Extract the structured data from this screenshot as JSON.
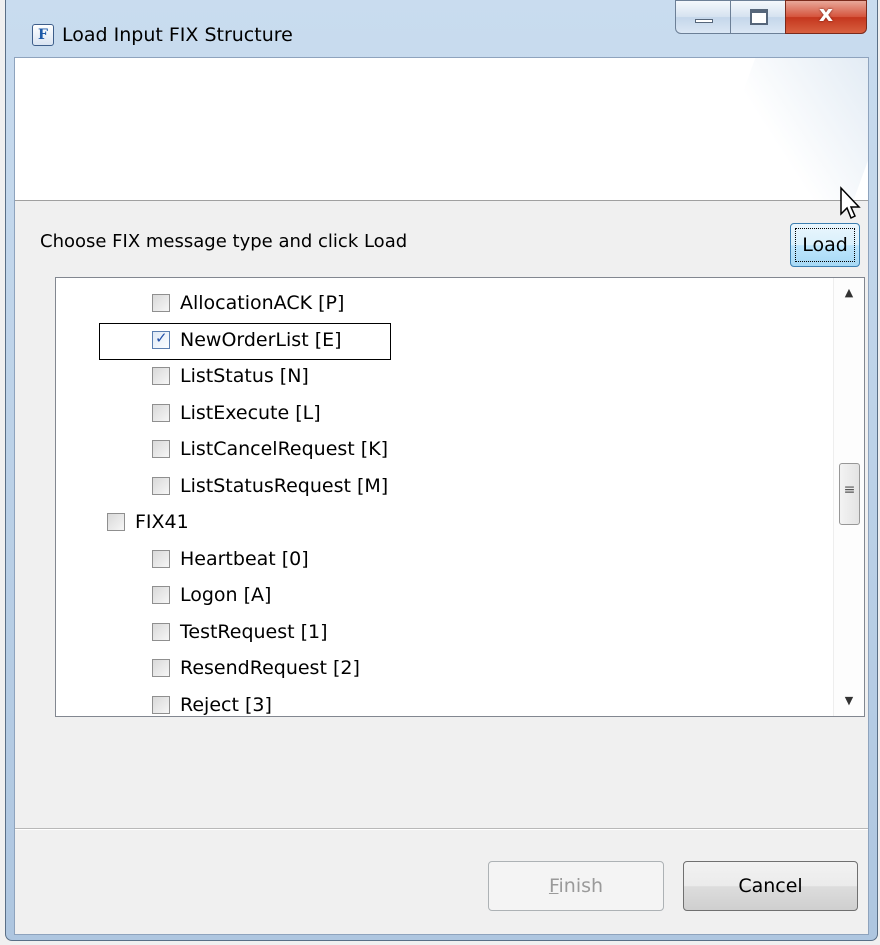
{
  "window": {
    "title": "Load Input FIX Structure",
    "app_icon_glyph": "F",
    "close_glyph": "x"
  },
  "content": {
    "prompt": "Choose FIX message type and click Load",
    "load_button": "Load"
  },
  "tree": {
    "items": [
      {
        "label": "AllocationACK [P]",
        "checked": false,
        "level": 2
      },
      {
        "label": "NewOrderList [E]",
        "checked": true,
        "level": 2
      },
      {
        "label": "ListStatus [N]",
        "checked": false,
        "level": 2
      },
      {
        "label": "ListExecute [L]",
        "checked": false,
        "level": 2
      },
      {
        "label": "ListCancelRequest [K]",
        "checked": false,
        "level": 2
      },
      {
        "label": "ListStatusRequest [M]",
        "checked": false,
        "level": 2
      },
      {
        "label": "FIX41",
        "checked": false,
        "level": 1
      },
      {
        "label": "Heartbeat [0]",
        "checked": false,
        "level": 2
      },
      {
        "label": "Logon [A]",
        "checked": false,
        "level": 2
      },
      {
        "label": "TestRequest [1]",
        "checked": false,
        "level": 2
      },
      {
        "label": "ResendRequest [2]",
        "checked": false,
        "level": 2
      },
      {
        "label": "Reject [3]",
        "checked": false,
        "level": 2
      }
    ],
    "scroll_up_icon": "triangle-up-icon",
    "scroll_down_icon": "triangle-down-icon"
  },
  "footer": {
    "finish_mnemonic": "F",
    "finish_rest": "inish",
    "finish_enabled": false,
    "cancel_label": "Cancel"
  }
}
